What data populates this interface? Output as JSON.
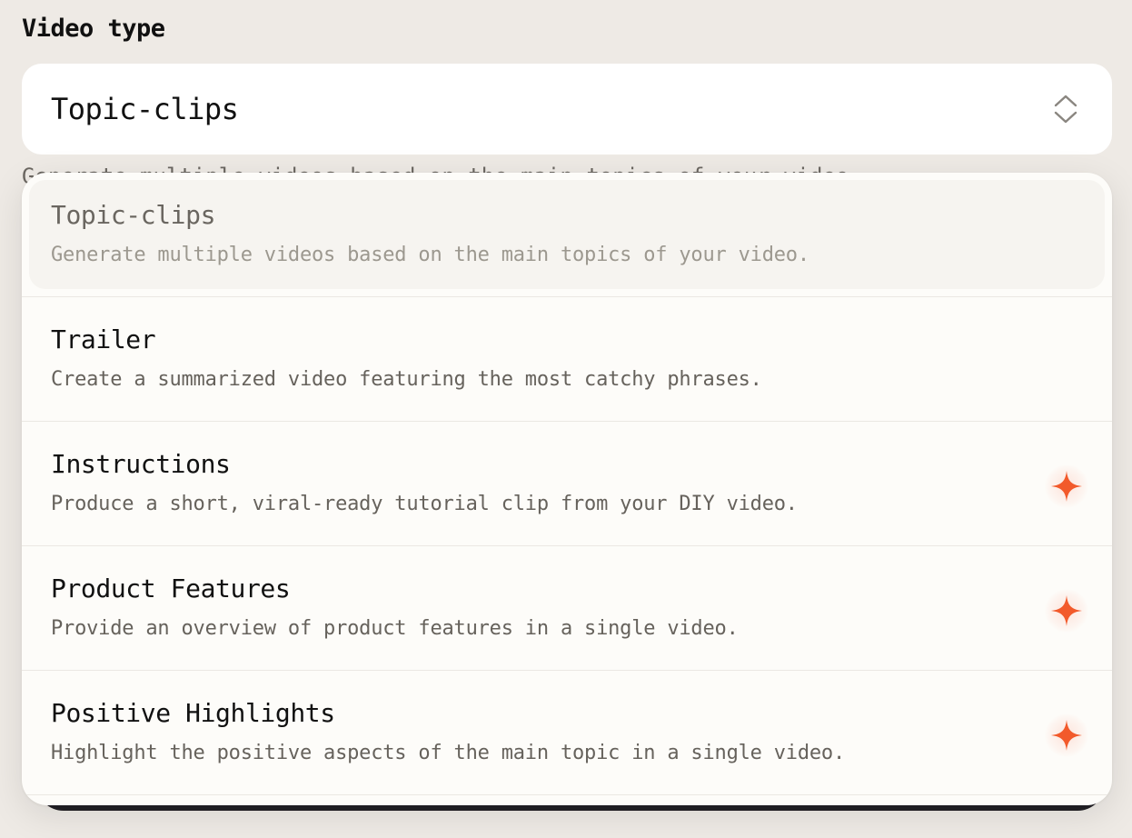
{
  "field": {
    "label": "Video type"
  },
  "select": {
    "value": "Topic-clips",
    "chevron_icon": "chevron-up-down-icon"
  },
  "behind": {
    "text": "Generate multiple videos based on the main topics of your video."
  },
  "options": [
    {
      "title": "Topic-clips",
      "description": "Generate multiple videos based on the main topics of your video.",
      "selected": true,
      "badge": ""
    },
    {
      "title": "Trailer",
      "description": "Create a summarized video featuring the most catchy phrases.",
      "selected": false,
      "badge": ""
    },
    {
      "title": "Instructions",
      "description": "Produce a short, viral-ready tutorial clip from your DIY video.",
      "selected": false,
      "badge": "sparkle-icon"
    },
    {
      "title": "Product Features",
      "description": "Provide an overview of product features in a single video.",
      "selected": false,
      "badge": "sparkle-icon"
    },
    {
      "title": "Positive Highlights",
      "description": "Highlight the positive aspects of the main topic in a single video.",
      "selected": false,
      "badge": "sparkle-icon"
    }
  ],
  "colors": {
    "page_background": "#eeeae5",
    "dropdown_background": "#fdfcf9",
    "sparkle_accent": "#f25a2b"
  }
}
